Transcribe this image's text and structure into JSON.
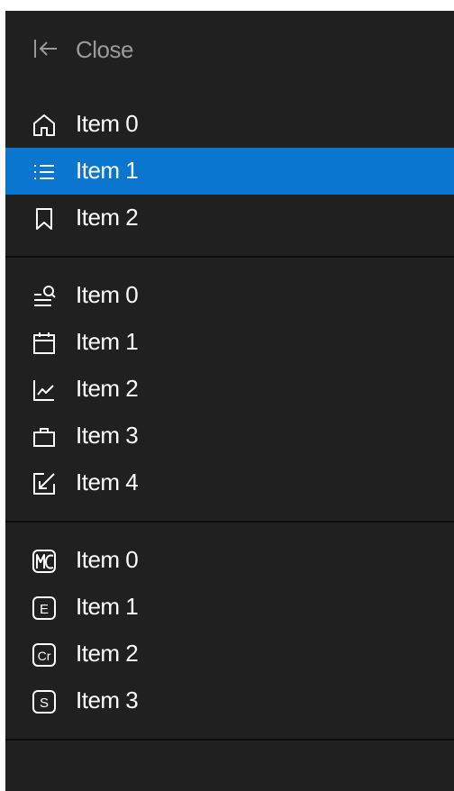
{
  "nav": {
    "close_label": "Close",
    "groups": [
      {
        "items": [
          {
            "label": "Item 0",
            "icon": "home-icon",
            "selected": false
          },
          {
            "label": "Item 1",
            "icon": "list-icon",
            "selected": true
          },
          {
            "label": "Item 2",
            "icon": "bookmark-icon",
            "selected": false
          }
        ]
      },
      {
        "items": [
          {
            "label": "Item 0",
            "icon": "search-list-icon",
            "selected": false
          },
          {
            "label": "Item 1",
            "icon": "calendar-icon",
            "selected": false
          },
          {
            "label": "Item 2",
            "icon": "line-chart-icon",
            "selected": false
          },
          {
            "label": "Item 3",
            "icon": "briefcase-icon",
            "selected": false
          },
          {
            "label": "Item 4",
            "icon": "arrow-in-box-icon",
            "selected": false
          }
        ]
      },
      {
        "items": [
          {
            "label": "Item 0",
            "icon": "mc-logo-icon",
            "selected": false
          },
          {
            "label": "Item 1",
            "icon": "letter-e-icon",
            "selected": false
          },
          {
            "label": "Item 2",
            "icon": "letter-cr-icon",
            "selected": false
          },
          {
            "label": "Item 3",
            "icon": "letter-s-icon",
            "selected": false
          }
        ]
      }
    ]
  },
  "colors": {
    "panel_bg": "#202020",
    "selected_bg": "#0a76cf",
    "text": "#ffffff",
    "muted_text": "#9a9a9a"
  },
  "icon_letters": {
    "letter_e": "E",
    "letter_cr": "Cr",
    "letter_s": "S"
  }
}
